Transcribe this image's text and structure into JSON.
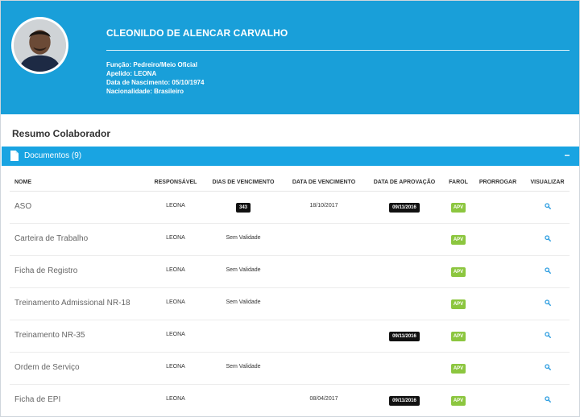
{
  "profile": {
    "name": "CLEONILDO DE ALENCAR CARVALHO",
    "info": [
      {
        "label": "Função:",
        "value": "Pedreiro/Meio Oficial"
      },
      {
        "label": "Apelido:",
        "value": "LEONA"
      },
      {
        "label": "Data de Nascimento:",
        "value": "05/10/1974"
      },
      {
        "label": "Nacionalidade:",
        "value": "Brasileiro"
      }
    ]
  },
  "section_title": "Resumo Colaborador",
  "panel": {
    "title": "Documentos (9)",
    "collapse_symbol": "−"
  },
  "table": {
    "headers": [
      "NOME",
      "RESPONSÁVEL",
      "DIAS DE VENCIMENTO",
      "DATA DE VENCIMENTO",
      "DATA DE APROVAÇÃO",
      "FAROL",
      "PRORROGAR",
      "VISUALIZAR"
    ],
    "rows": [
      {
        "nome": "ASO",
        "responsavel": "LEONA",
        "dias": "343",
        "dias_badge": true,
        "data_venc": "18/10/2017",
        "data_aprov": "09/11/2016",
        "farol": "APV"
      },
      {
        "nome": "Carteira de Trabalho",
        "responsavel": "LEONA",
        "dias": "Sem Validade",
        "dias_badge": false,
        "data_venc": "",
        "data_aprov": "",
        "farol": "APV"
      },
      {
        "nome": "Ficha de Registro",
        "responsavel": "LEONA",
        "dias": "Sem Validade",
        "dias_badge": false,
        "data_venc": "",
        "data_aprov": "",
        "farol": "APV"
      },
      {
        "nome": "Treinamento Admissional NR-18",
        "responsavel": "LEONA",
        "dias": "Sem Validade",
        "dias_badge": false,
        "data_venc": "",
        "data_aprov": "",
        "farol": "APV"
      },
      {
        "nome": "Treinamento NR-35",
        "responsavel": "LEONA",
        "dias": "",
        "dias_badge": false,
        "data_venc": "",
        "data_aprov": "09/11/2016",
        "farol": "APV"
      },
      {
        "nome": "Ordem de Serviço",
        "responsavel": "LEONA",
        "dias": "Sem Validade",
        "dias_badge": false,
        "data_venc": "",
        "data_aprov": "",
        "farol": "APV"
      },
      {
        "nome": "Ficha de EPI",
        "responsavel": "LEONA",
        "dias": "",
        "dias_badge": false,
        "data_venc": "08/04/2017",
        "data_aprov": "09/11/2016",
        "farol": "APV"
      }
    ]
  },
  "colors": {
    "header_bg": "#199fd9",
    "panel_bg": "#19a4e2",
    "farol_green": "#8cc63f",
    "badge_dark": "#111111",
    "icon_blue": "#2d9de0"
  },
  "icons": {
    "panel": "document-icon",
    "view": "search-icon"
  }
}
